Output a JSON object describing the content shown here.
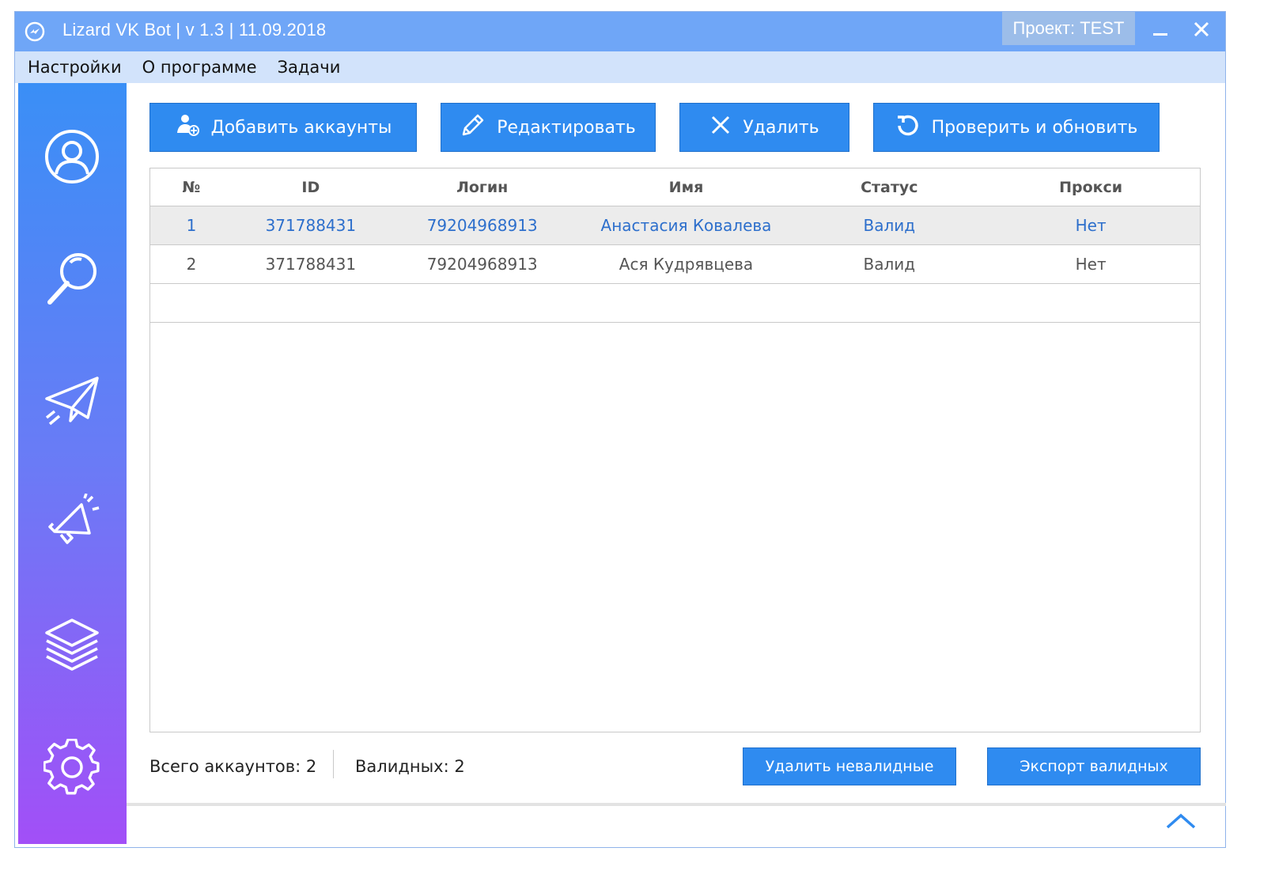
{
  "window": {
    "title": "Lizard VK Bot | v 1.3 | 11.09.2018",
    "project": "Проект: TEST",
    "accent_color": "#2f8bf0",
    "titlebar_color": "#6fa6f7"
  },
  "menu": {
    "items": [
      {
        "label": "Настройки"
      },
      {
        "label": "О программе"
      },
      {
        "label": "Задачи"
      }
    ]
  },
  "sidebar": {
    "icons": [
      "user-circle-icon",
      "search-icon",
      "paper-plane-icon",
      "megaphone-icon",
      "layers-icon",
      "gear-icon"
    ]
  },
  "toolbar": {
    "add_label": "Добавить аккаунты",
    "edit_label": "Редактировать",
    "delete_label": "Удалить",
    "check_label": "Проверить и обновить"
  },
  "table": {
    "columns": [
      "№",
      "ID",
      "Логин",
      "Имя",
      "Статус",
      "Прокси"
    ],
    "rows": [
      {
        "num": "1",
        "id": "371788431",
        "login": "79204968913",
        "name": "Анастасия Ковалева",
        "status": "Валид",
        "proxy": "Нет"
      },
      {
        "num": "2",
        "id": "371788431",
        "login": "79204968913",
        "name": "Ася Кудрявцева",
        "status": "Валид",
        "proxy": "Нет"
      }
    ]
  },
  "footer": {
    "total_label": "Всего аккаунтов: 2",
    "valid_label": "Валидных: 2",
    "delete_invalid_label": "Удалить невалидные",
    "export_valid_label": "Экспорт валидных"
  }
}
